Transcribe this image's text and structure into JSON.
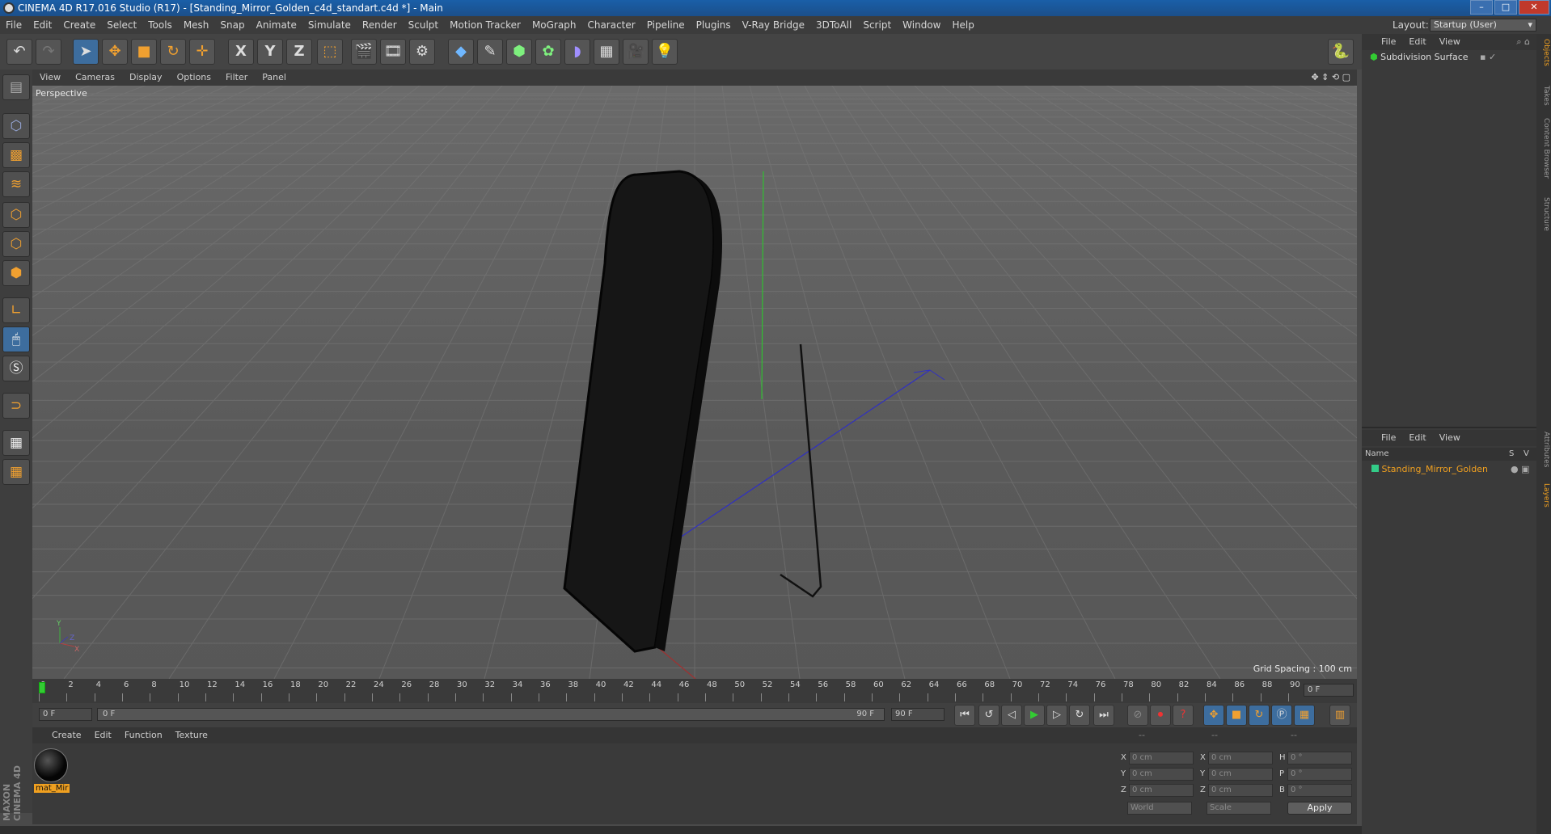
{
  "window": {
    "title": "CINEMA 4D R17.016 Studio (R17) - [Standing_Mirror_Golden_c4d_standart.c4d *] - Main",
    "buttons": {
      "minimize": "–",
      "maximize": "□",
      "close": "✕"
    }
  },
  "menubar": {
    "items": [
      "File",
      "Edit",
      "Create",
      "Select",
      "Tools",
      "Mesh",
      "Snap",
      "Animate",
      "Simulate",
      "Render",
      "Sculpt",
      "Motion Tracker",
      "MoGraph",
      "Character",
      "Pipeline",
      "Plugins",
      "V-Ray Bridge",
      "3DToAll",
      "Script",
      "Window",
      "Help"
    ],
    "layout_label": "Layout:",
    "layout_value": "Startup (User)"
  },
  "toolbar": {
    "icons": [
      "undo-icon",
      "redo-icon",
      "select-cursor-icon",
      "move-icon",
      "scale-icon",
      "rotate-icon",
      "live-select-icon",
      "x-axis-icon",
      "y-axis-icon",
      "z-axis-icon",
      "coordinate-system-icon",
      "render-view-icon",
      "render-picture-viewer-icon",
      "edit-render-settings-icon",
      "cube-icon",
      "pen-icon",
      "subdivision-icon",
      "cloner-icon",
      "deformer-icon",
      "floor-icon",
      "camera-icon",
      "light-icon",
      "python-icon"
    ],
    "axis_labels": [
      "X",
      "Y",
      "Z"
    ]
  },
  "viewport": {
    "menu": [
      "View",
      "Cameras",
      "Display",
      "Options",
      "Filter",
      "Panel"
    ],
    "label": "Perspective",
    "grid_spacing": "Grid Spacing : 100 cm",
    "axis_labels": {
      "y": "Y",
      "x": "X",
      "z": "Z"
    }
  },
  "timeline": {
    "ticks": [
      "0",
      "2",
      "4",
      "6",
      "8",
      "10",
      "12",
      "14",
      "16",
      "18",
      "20",
      "22",
      "24",
      "26",
      "28",
      "30",
      "32",
      "34",
      "36",
      "38",
      "40",
      "42",
      "44",
      "46",
      "48",
      "50",
      "52",
      "54",
      "56",
      "58",
      "60",
      "62",
      "64",
      "66",
      "68",
      "70",
      "72",
      "74",
      "76",
      "78",
      "80",
      "82",
      "84",
      "86",
      "88",
      "90"
    ],
    "current_frame": "0 F",
    "start_field": "0 F",
    "range_start": "0 F",
    "range_end": "90 F",
    "end_field": "90 F"
  },
  "materials": {
    "menu": [
      "Create",
      "Edit",
      "Function",
      "Texture"
    ],
    "items": [
      {
        "name": "mat_Mir"
      }
    ]
  },
  "coordinates": {
    "headers": [
      "--",
      "--",
      "--"
    ],
    "rows": [
      {
        "l1": "X",
        "v1": "0 cm",
        "l2": "X",
        "v2": "0 cm",
        "l3": "H",
        "v3": "0 °"
      },
      {
        "l1": "Y",
        "v1": "0 cm",
        "l2": "Y",
        "v2": "0 cm",
        "l3": "P",
        "v3": "0 °"
      },
      {
        "l1": "Z",
        "v1": "0 cm",
        "l2": "Z",
        "v2": "0 cm",
        "l3": "B",
        "v3": "0 °"
      }
    ],
    "world_select": "World",
    "scale_select": "Scale",
    "apply_label": "Apply"
  },
  "objects_panel": {
    "menu": [
      "File",
      "Edit",
      "View"
    ],
    "items": [
      {
        "name": "Subdivision Surface"
      }
    ]
  },
  "layers_panel": {
    "menu": [
      "File",
      "Edit",
      "View"
    ],
    "col_name": "Name",
    "col_s": "S",
    "col_v": "V",
    "items": [
      {
        "name": "Standing_Mirror_Golden"
      }
    ]
  },
  "side_tabs": [
    "Objects",
    "Takes",
    "Content Browser",
    "Structure",
    "Attributes",
    "Layers"
  ],
  "branding": "MAXON CINEMA 4D"
}
